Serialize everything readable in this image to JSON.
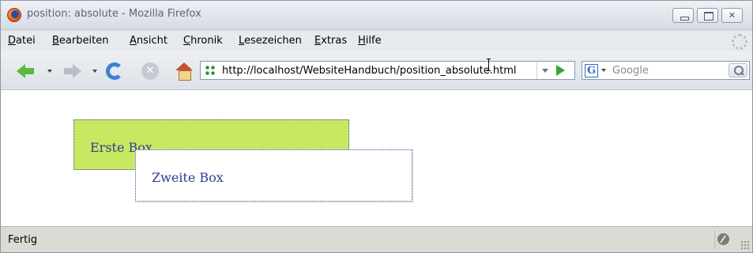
{
  "window": {
    "title": "position: absolute - Mozilla Firefox",
    "buttons": [
      "minimize",
      "maximize",
      "close"
    ]
  },
  "menu": {
    "items": [
      "Datei",
      "Bearbeiten",
      "Ansicht",
      "Chronik",
      "Lesezeichen",
      "Extras",
      "Hilfe"
    ]
  },
  "toolbar": {
    "icons": [
      "back-icon",
      "forward-icon",
      "reload-icon",
      "stop-icon",
      "home-icon",
      "go-icon"
    ],
    "url": "http://localhost/WebsiteHandbuch/position_absolute.html"
  },
  "search": {
    "engine_icon": "G",
    "placeholder": "Google"
  },
  "content": {
    "box1_label": "Erste Box",
    "box2_label": "Zweite Box",
    "box1_color": "#c8e862",
    "border_color": "#334ea0",
    "text_color": "#2e3d92"
  },
  "status": {
    "text": "Fertig"
  }
}
